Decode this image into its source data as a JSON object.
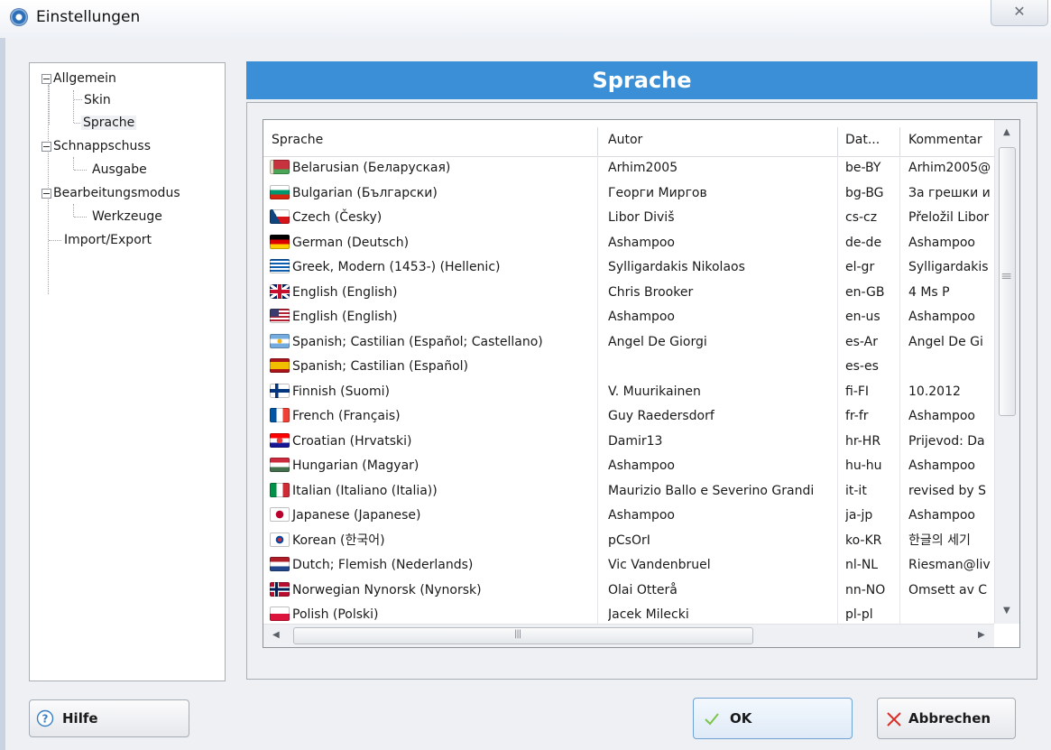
{
  "window": {
    "title": "Einstellungen",
    "close_glyph": "✕",
    "icon": "app-camera-icon"
  },
  "tree": {
    "items": [
      {
        "label": "Allgemein",
        "level": 0,
        "expanded": true
      },
      {
        "label": "Skin",
        "level": 1
      },
      {
        "label": "Sprache",
        "level": 1,
        "selected": true
      },
      {
        "label": "Schnappschuss",
        "level": 0,
        "expanded": true
      },
      {
        "label": "Ausgabe",
        "level": 1
      },
      {
        "label": "Bearbeitungsmodus",
        "level": 0,
        "expanded": true
      },
      {
        "label": "Werkzeuge",
        "level": 1
      },
      {
        "label": "Import/Export",
        "level": 0
      }
    ]
  },
  "panel": {
    "title": "Sprache",
    "title_bg": "#3a8fd6"
  },
  "table": {
    "columns": [
      "Sprache",
      "Autor",
      "Dat...",
      "Kommentar"
    ],
    "rows": [
      {
        "flag": "by",
        "language": "Belarusian (Беларуская)",
        "author": "Arhim2005",
        "code": "be-BY",
        "comment": "Arhim2005@"
      },
      {
        "flag": "bg",
        "language": "Bulgarian (Български)",
        "author": "Георги Миргов",
        "code": "bg-BG",
        "comment": "За грешки и"
      },
      {
        "flag": "cz",
        "language": "Czech (Česky)",
        "author": "Libor Diviš",
        "code": "cs-cz",
        "comment": "Přeložil Libor"
      },
      {
        "flag": "de",
        "language": "German (Deutsch)",
        "author": "Ashampoo",
        "code": "de-de",
        "comment": "Ashampoo"
      },
      {
        "flag": "gr",
        "language": "Greek, Modern (1453-) (Hellenic)",
        "author": "Sylligardakis Nikolaos",
        "code": "el-gr",
        "comment": "Sylligardakis"
      },
      {
        "flag": "gb",
        "language": "English (English)",
        "author": "Chris Brooker",
        "code": "en-GB",
        "comment": "4 Ms P"
      },
      {
        "flag": "us",
        "language": "English (English)",
        "author": "Ashampoo",
        "code": "en-us",
        "comment": "Ashampoo"
      },
      {
        "flag": "ar",
        "language": "Spanish; Castilian (Español; Castellano)",
        "author": "Angel De Giorgi",
        "code": "es-Ar",
        "comment": "Angel De Gi"
      },
      {
        "flag": "es",
        "language": "Spanish; Castilian (Español)",
        "author": "",
        "code": "es-es",
        "comment": ""
      },
      {
        "flag": "fi",
        "language": "Finnish (Suomi)",
        "author": "V. Muurikainen",
        "code": "fi-FI",
        "comment": "10.2012"
      },
      {
        "flag": "fr",
        "language": "French (Français)",
        "author": "Guy Raedersdorf",
        "code": "fr-fr",
        "comment": "Ashampoo"
      },
      {
        "flag": "hr",
        "language": "Croatian (Hrvatski)",
        "author": "Damir13",
        "code": "hr-HR",
        "comment": "Prijevod: Da"
      },
      {
        "flag": "hu",
        "language": "Hungarian (Magyar)",
        "author": "Ashampoo",
        "code": "hu-hu",
        "comment": "Ashampoo"
      },
      {
        "flag": "it",
        "language": "Italian (Italiano (Italia))",
        "author": "Maurizio Ballo e Severino Grandi",
        "code": "it-it",
        "comment": "revised by S"
      },
      {
        "flag": "jp",
        "language": "Japanese (Japanese)",
        "author": "Ashampoo",
        "code": "ja-jp",
        "comment": "Ashampoo"
      },
      {
        "flag": "kr",
        "language": "Korean (한국어)",
        "author": "pCsOrI",
        "code": "ko-KR",
        "comment": "한글의 세기"
      },
      {
        "flag": "nl",
        "language": "Dutch; Flemish (Nederlands)",
        "author": "Vic Vandenbruel",
        "code": "nl-NL",
        "comment": "Riesman@liv"
      },
      {
        "flag": "no",
        "language": "Norwegian Nynorsk (Nynorsk)",
        "author": "Olai Otterå",
        "code": "nn-NO",
        "comment": "Omsett av C"
      },
      {
        "flag": "pl",
        "language": "Polish (Polski)",
        "author": "Jacek Milecki",
        "code": "pl-pl",
        "comment": ""
      }
    ]
  },
  "buttons": {
    "help": {
      "label": "Hilfe",
      "icon": "help-question-icon"
    },
    "ok": {
      "label": "OK",
      "icon": "checkmark-icon"
    },
    "cancel": {
      "label": "Abbrechen",
      "icon": "cross-icon"
    }
  }
}
